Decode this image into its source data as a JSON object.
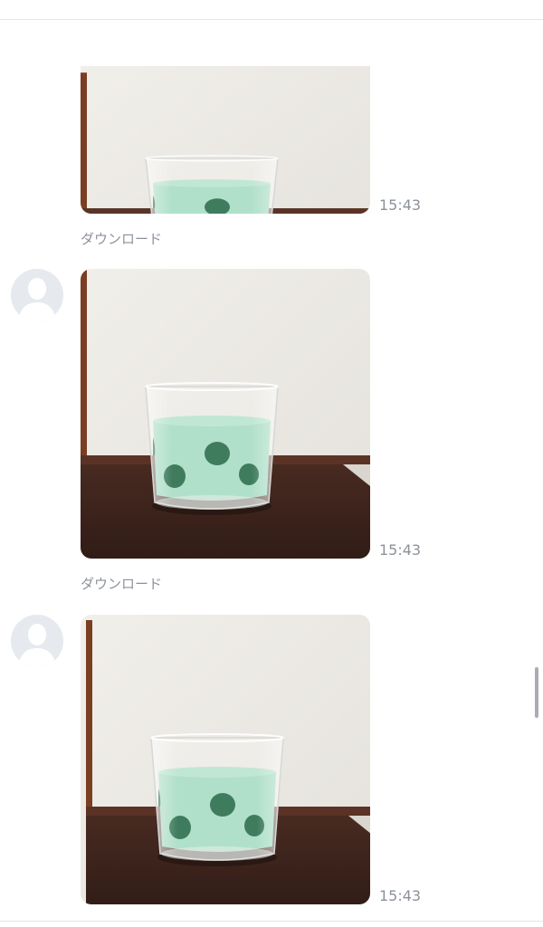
{
  "chat": {
    "messages": [
      {
        "time": "15:43",
        "download_label": "ダウンロード"
      },
      {
        "time": "15:43",
        "download_label": "ダウンロード"
      },
      {
        "time": "15:43"
      }
    ]
  },
  "colors": {
    "wall": "#efede8",
    "table": "#3f2620",
    "sand": "#a8dcc4",
    "dots": "#2a6e4c",
    "meta_text": "#8c929a"
  }
}
